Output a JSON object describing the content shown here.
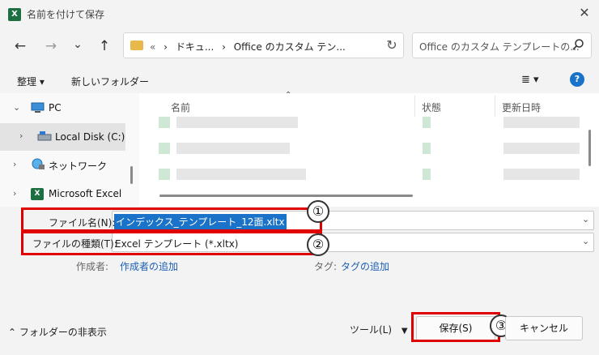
{
  "window": {
    "title": "名前を付けて保存",
    "app_icon_letter": "X",
    "close_label": "✕"
  },
  "nav": {
    "back": "←",
    "forward": "→",
    "recent": "⌄",
    "up": "↑"
  },
  "address": {
    "overflow": "«",
    "crumbs": [
      "ドキュ...",
      "Office のカスタム テン..."
    ],
    "separator": "›",
    "refresh": "↻"
  },
  "search": {
    "placeholder": "Office のカスタム テンプレートの...",
    "icon": "search-icon"
  },
  "toolbar": {
    "organize": "整理 ▾",
    "new_folder": "新しいフォルダー",
    "view": "≣ ▾",
    "help": "?"
  },
  "navpane": {
    "items": [
      {
        "label": "PC",
        "chevron": "⌄"
      },
      {
        "label": "Local Disk (C:)",
        "chevron": "›"
      },
      {
        "label": "ネットワーク",
        "chevron": "›"
      },
      {
        "label": "Microsoft Excel",
        "chevron": "›"
      }
    ]
  },
  "columns": {
    "name": "名前",
    "status": "状態",
    "modified": "更新日時",
    "sort_arrow": "⌃"
  },
  "file_name": {
    "label": "ファイル名(N):",
    "value": "インデックス_テンプレート_12面.xltx"
  },
  "file_type": {
    "label": "ファイルの種類(T):",
    "value": "Excel テンプレート (*.xltx)"
  },
  "meta": {
    "author_label": "作成者:",
    "author_link": "作成者の追加",
    "tag_label": "タグ:",
    "tag_link": "タグの追加"
  },
  "footer": {
    "hide_folders": "⌃ フォルダーの非表示",
    "tools": "ツール(L)",
    "tools_arrow": "▼",
    "save": "保存(S)",
    "cancel": "キャンセル"
  },
  "annotations": {
    "one": "①",
    "two": "②",
    "three": "③"
  },
  "colors": {
    "highlight": "#e00000",
    "accent": "#1a73c8",
    "excel_green": "#1d6f42"
  }
}
